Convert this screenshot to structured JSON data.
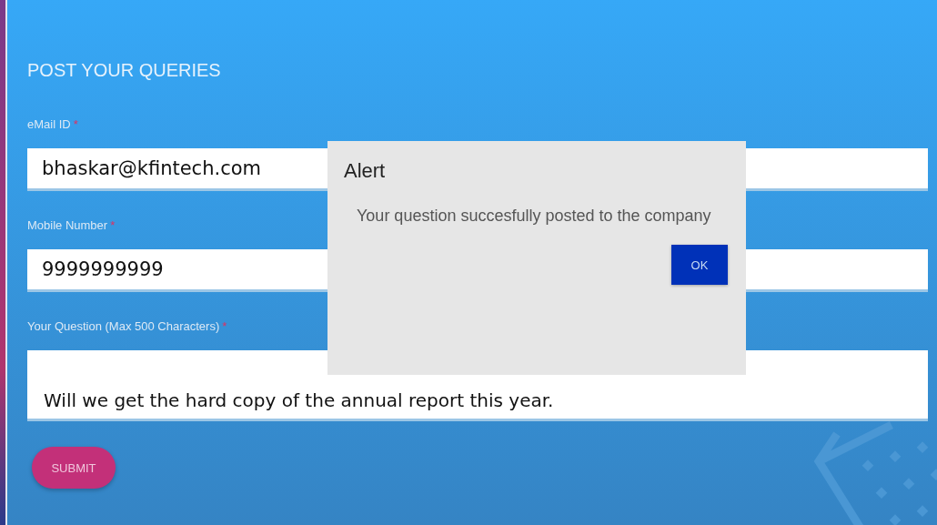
{
  "form": {
    "title": "POST YOUR QUERIES",
    "fields": [
      {
        "kind": "input",
        "label": "eMail ID",
        "required_mark": "*",
        "value": "bhaskar@kfintech.com"
      },
      {
        "kind": "input",
        "label": "Mobile Number",
        "required_mark": "*",
        "value": "9999999999"
      },
      {
        "kind": "textarea",
        "label": "Your Question (Max 500 Characters)",
        "required_mark": "*",
        "value": "Will we get the hard copy of the annual report this year."
      }
    ],
    "submit": "SUBMIT"
  },
  "alert": {
    "title": "Alert",
    "message": "Your question succesfully posted to the company",
    "button": "OK"
  }
}
